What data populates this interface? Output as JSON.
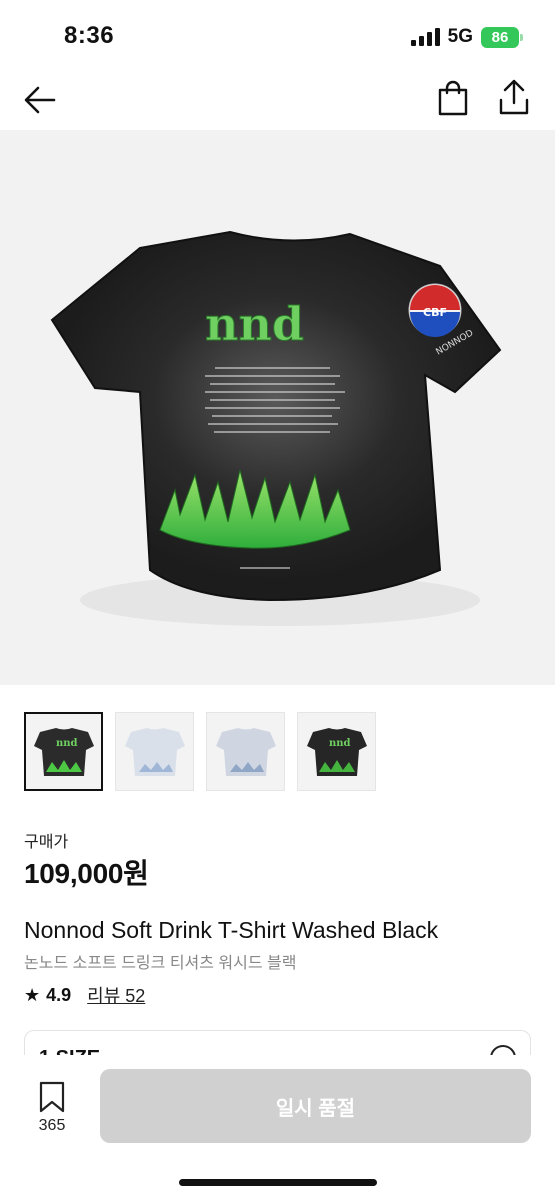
{
  "status_bar": {
    "time": "8:36",
    "network": "5G",
    "battery": "86"
  },
  "nav": {
    "back_icon": "arrow-left-icon",
    "bag_icon": "shopping-bag-icon",
    "share_icon": "share-icon"
  },
  "product": {
    "price_label": "구매가",
    "price": "109,000원",
    "name_en": "Nonnod Soft Drink T-Shirt Washed Black",
    "name_ko": "논노드 소프트 드링크 티셔츠 워시드 블랙",
    "rating": "4.9",
    "review_label": "리뷰 52",
    "size_label": "1 SIZE"
  },
  "thumbnails": [
    {
      "variant": "black",
      "selected": true
    },
    {
      "variant": "white",
      "selected": false
    },
    {
      "variant": "white",
      "selected": false
    },
    {
      "variant": "black",
      "selected": false
    }
  ],
  "bottom_bar": {
    "wish_count": "365",
    "button_label": "일시 품절"
  },
  "colors": {
    "accent_green": "#34c759",
    "button_disabled": "#d0d0d0",
    "shirt": "#222222",
    "flame": "#4cc845"
  }
}
